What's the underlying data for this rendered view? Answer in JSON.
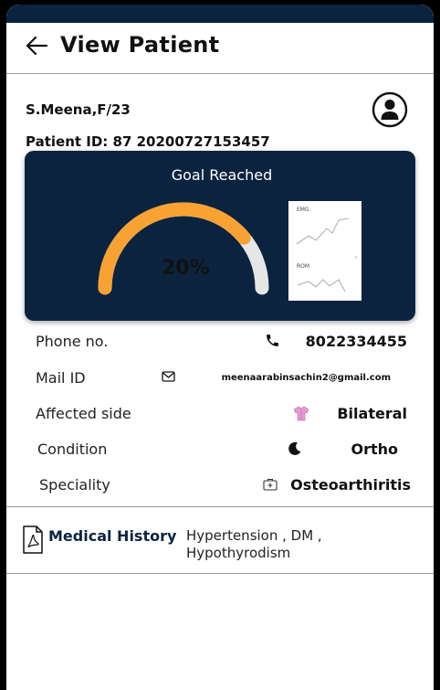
{
  "header": {
    "title": "View Patient"
  },
  "patient": {
    "name_line": "S.Meena,F/23",
    "id_line": "Patient ID: 87 20200727153457"
  },
  "goal_card": {
    "title": "Goal Reached",
    "percent_label": "20%",
    "gauge_value_fraction": 0.78,
    "chart_labels": {
      "emg": "EMG",
      "rom": "ROM"
    }
  },
  "details": [
    {
      "label": "Phone no.",
      "icon": "phone-icon",
      "value": "8022334455"
    },
    {
      "label": "Mail ID",
      "icon": "mail-icon",
      "value": "meenaarabinsachin2@gmail.com"
    },
    {
      "label": "Affected side",
      "icon": "shirt-icon",
      "value": "Bilateral"
    },
    {
      "label": "Condition",
      "icon": "moon-icon",
      "value": "Ortho"
    },
    {
      "label": "Speciality",
      "icon": "medical-kit-icon",
      "value": "Osteoarthiritis"
    }
  ],
  "medical_history": {
    "label": "Medical History",
    "text": "Hypertension , DM , Hypothyrodism"
  },
  "colors": {
    "navy": "#0c2340",
    "gauge_orange": "#f7a233",
    "gauge_gray": "#e6e6e6",
    "shirt_pink": "#e89ad8"
  }
}
